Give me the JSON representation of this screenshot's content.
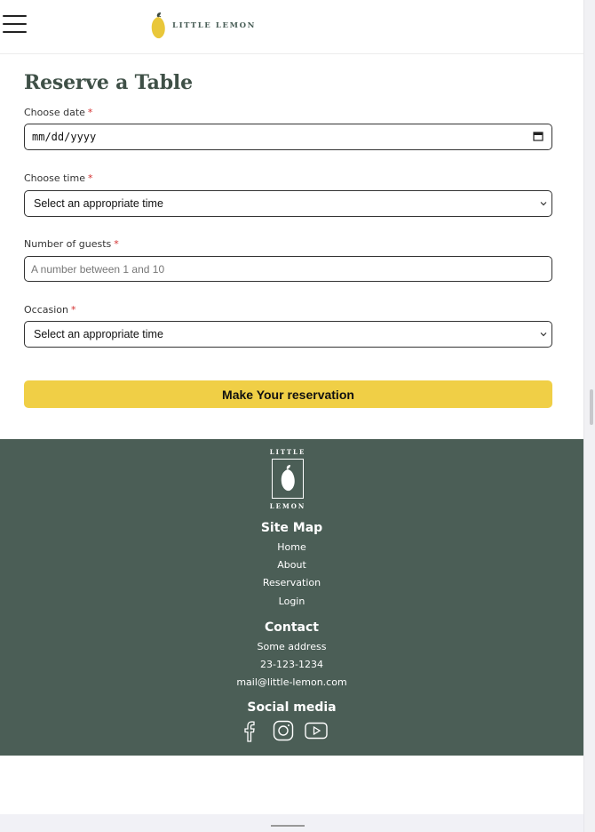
{
  "brand": {
    "name": "LITTLE LEMON"
  },
  "form": {
    "title": "Reserve a Table",
    "required_mark": "*",
    "date": {
      "label": "Choose date",
      "value": "mm/dd/yyyy"
    },
    "time": {
      "label": "Choose time",
      "value": "Select an appropriate time"
    },
    "guests": {
      "label": "Number of guests",
      "placeholder": "A number between 1 and 10"
    },
    "occasion": {
      "label": "Occasion",
      "value": "Select an appropriate time"
    },
    "submit_label": "Make Your reservation"
  },
  "footer": {
    "logo_top": "LITTLE",
    "logo_bottom": "LEMON",
    "site_map": {
      "heading": "Site Map",
      "links": [
        "Home",
        "About",
        "Reservation",
        "Login"
      ]
    },
    "contact": {
      "heading": "Contact",
      "lines": [
        "Some address",
        "23-123-1234",
        "mail@little-lemon.com"
      ]
    },
    "social": {
      "heading": "Social media",
      "icons": [
        "facebook-icon",
        "instagram-icon",
        "youtube-icon"
      ]
    }
  },
  "colors": {
    "accent": "#f0cf46",
    "footer_bg": "#4b5e56",
    "heading": "#3f5047",
    "required": "#d32f2f"
  }
}
